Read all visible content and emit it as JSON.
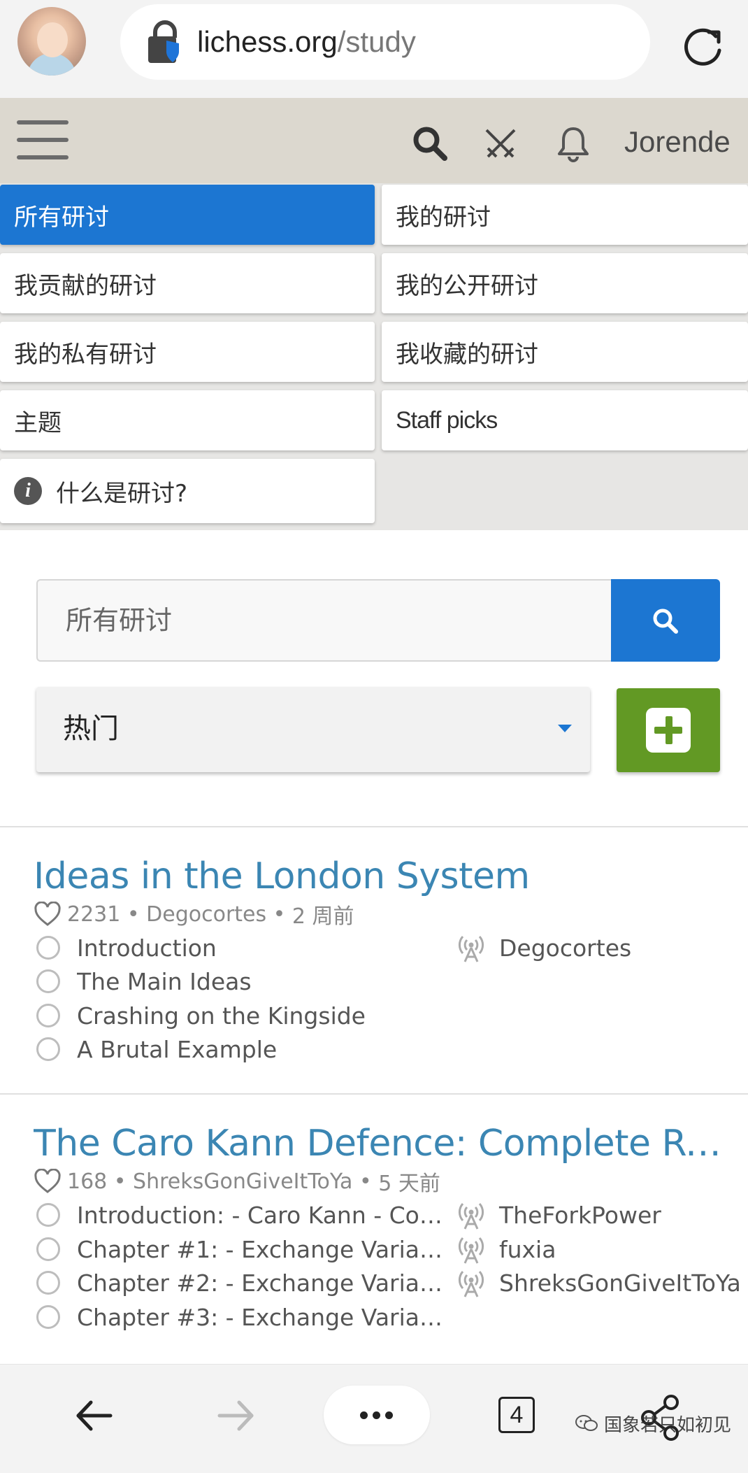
{
  "browser": {
    "url_domain": "lichess.org",
    "url_path": "/study",
    "tab_count": "4"
  },
  "header": {
    "username": "Jorende"
  },
  "menu": {
    "items": [
      {
        "label": "所有研讨",
        "active": true
      },
      {
        "label": "我的研讨",
        "active": false
      },
      {
        "label": "我贡献的研讨",
        "active": false
      },
      {
        "label": "我的公开研讨",
        "active": false
      },
      {
        "label": "我的私有研讨",
        "active": false
      },
      {
        "label": "我收藏的研讨",
        "active": false
      },
      {
        "label": "主题",
        "active": false
      },
      {
        "label": "Staff picks",
        "active": false
      }
    ],
    "info_label": "什么是研讨?"
  },
  "search": {
    "placeholder": "所有研讨"
  },
  "sort": {
    "selected": "热门"
  },
  "studies": [
    {
      "title": "Ideas in the London System",
      "likes": "2231",
      "owner": "Degocortes",
      "age": "2 周前",
      "chapters": [
        "Introduction",
        "The Main Ideas",
        "Crashing on the Kingside",
        "A Brutal Example"
      ],
      "members": [
        "Degocortes"
      ]
    },
    {
      "title": "The Caro Kann Defence: Complete Rep...",
      "likes": "168",
      "owner": "ShreksGonGiveItToYa",
      "age": "5 天前",
      "chapters": [
        "Introduction: - Caro Kann - Com...",
        "Chapter #1: - Exchange Variatio...",
        "Chapter #2: - Exchange Variatio...",
        "Chapter #3: - Exchange Variatio..."
      ],
      "members": [
        "TheForkPower",
        "fuxia",
        "ShreksGonGiveItToYa"
      ]
    }
  ],
  "watermark": {
    "text": "国象若只如初见"
  },
  "colors": {
    "accent_blue": "#1c76d2",
    "new_green": "#629924",
    "title_blue": "#3b86b3",
    "header_bg": "#dcd8cf"
  },
  "icons": {
    "header": [
      "search-icon",
      "crossed-swords-icon",
      "bell-icon"
    ],
    "bottom": [
      "back-arrow-icon",
      "forward-arrow-icon",
      "more-icon",
      "tabs-icon",
      "share-icon"
    ]
  }
}
